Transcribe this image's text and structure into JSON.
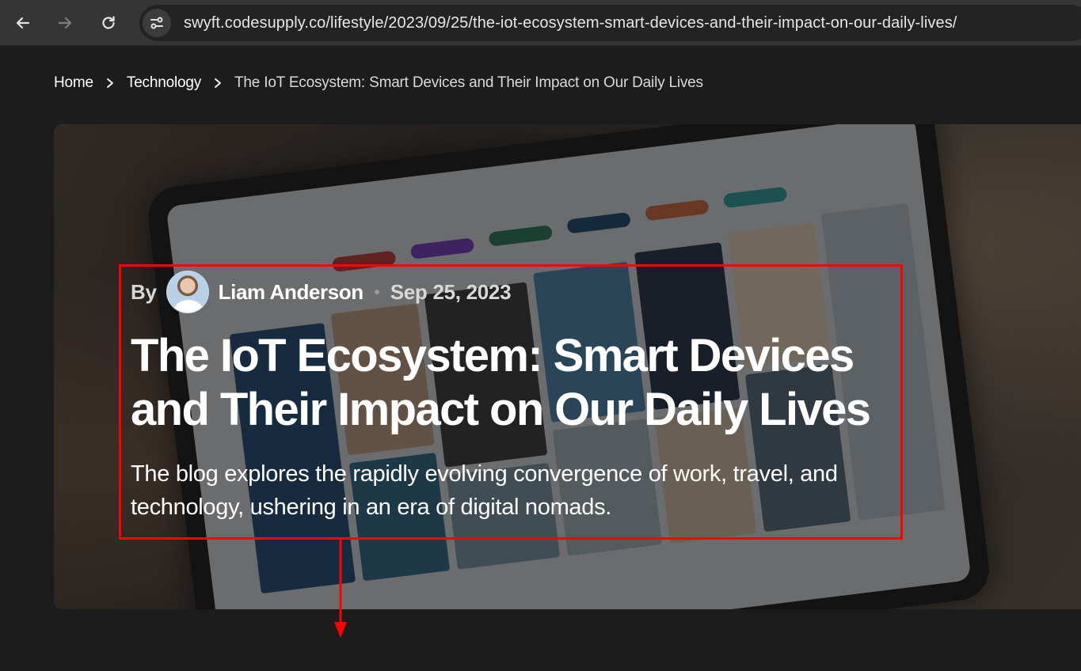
{
  "browser": {
    "url": "swyft.codesupply.co/lifestyle/2023/09/25/the-iot-ecosystem-smart-devices-and-their-impact-on-our-daily-lives/"
  },
  "breadcrumb": {
    "items": [
      "Home",
      "Technology"
    ],
    "current": "The IoT Ecosystem: Smart Devices and Their Impact on Our Daily Lives"
  },
  "hero": {
    "by_label": "By",
    "author": "Liam Anderson",
    "date": "Sep 25, 2023",
    "title": "The IoT Ecosystem: Smart Devices and Their Impact on Our Daily Lives",
    "excerpt": "The blog explores the rapidly evolving convergence of work, travel, and technology, ushering in an era of digital nomads."
  },
  "annotation": {
    "color": "#ff0000"
  }
}
